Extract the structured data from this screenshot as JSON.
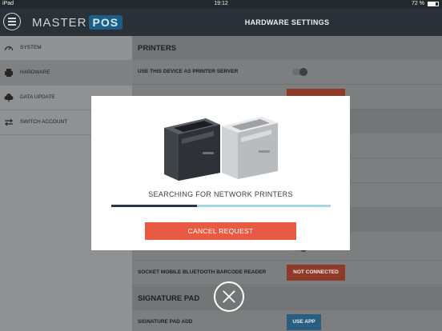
{
  "status_bar": {
    "carrier": "iPad",
    "time": "19:12",
    "battery": "72 %"
  },
  "header": {
    "logo_text": "MASTER",
    "logo_badge": "POS",
    "title": "HARDWARE SETTINGS"
  },
  "sidebar": {
    "items": [
      {
        "label": "SYSTEM",
        "icon": "gauge-icon"
      },
      {
        "label": "HARDWARE",
        "icon": "printer-icon"
      },
      {
        "label": "DATA UPDATE",
        "icon": "cloud-icon"
      },
      {
        "label": "SWITCH ACCOUNT",
        "icon": "switch-arrows-icon"
      }
    ]
  },
  "main": {
    "printers_heading": "PRINTERS",
    "printer_server_label": "USE THIS DEVICE AS PRINTER SERVER",
    "barcode_reader_label": "SOCKET MOBILE BLUETOOTH BARCODE READER",
    "barcode_status": "NOT CONNECTED",
    "signature_heading": "SIGNATURE PAD",
    "signature_label": "SIGNATURE PAD ADD",
    "signature_button": "USE APP"
  },
  "modal": {
    "message": "SEARCHING FOR NETWORK PRINTERS",
    "progress": 0.39,
    "cancel_label": "CANCEL REQUEST"
  },
  "colors": {
    "accent_red": "#e85a44",
    "accent_blue": "#2a5e80",
    "progress_track": "#a9d4e6",
    "progress_fill": "#2b3440"
  }
}
